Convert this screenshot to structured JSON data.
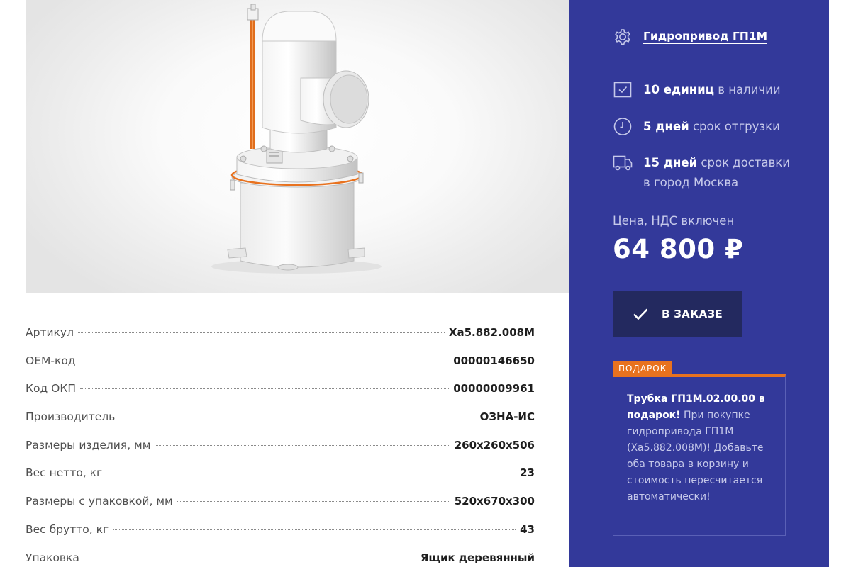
{
  "product": {
    "name": "Гидропривод ГП1М"
  },
  "availability": {
    "stock_strong": "10 единиц",
    "stock_rest": " в наличии",
    "shipping_strong": "5 дней",
    "shipping_rest": " срок отгрузки",
    "delivery_strong": "15 дней",
    "delivery_rest": " срок доставки в город Москва"
  },
  "price": {
    "label": "Цена, НДС включен",
    "value": "64 800 ₽"
  },
  "order_button": {
    "label": "В ЗАКАЗЕ"
  },
  "gift": {
    "tag": "ПОДАРОК",
    "title": "Трубка ГП1М.02.00.00 в подарок!",
    "text": " При покупке гидропривода ГП1М (Ха5.882.008М)! Добавьте оба товара в корзину и стоимость пересчитается автоматически!"
  },
  "specs": [
    {
      "label": "Артикул",
      "value": "Ха5.882.008М"
    },
    {
      "label": "ОЕМ-код",
      "value": "00000146650"
    },
    {
      "label": "Код ОКП",
      "value": "00000009961"
    },
    {
      "label": "Производитель",
      "value": "ОЗНА-ИС"
    },
    {
      "label": "Размеры изделия, мм",
      "value": "260x260x506"
    },
    {
      "label": "Вес нетто, кг",
      "value": "23"
    },
    {
      "label": "Размеры с упаковкой, мм",
      "value": "520x670x300"
    },
    {
      "label": "Вес брутто, кг",
      "value": "43"
    },
    {
      "label": "Упаковка",
      "value": "Ящик деревянный"
    }
  ],
  "colors": {
    "panel": "#33399a",
    "button": "#23295f",
    "accent": "#e8721f"
  },
  "icons": {
    "product": "gear-icon",
    "stock": "checkbox-icon",
    "shipping": "clock-icon",
    "delivery": "truck-icon",
    "order": "check-icon"
  }
}
